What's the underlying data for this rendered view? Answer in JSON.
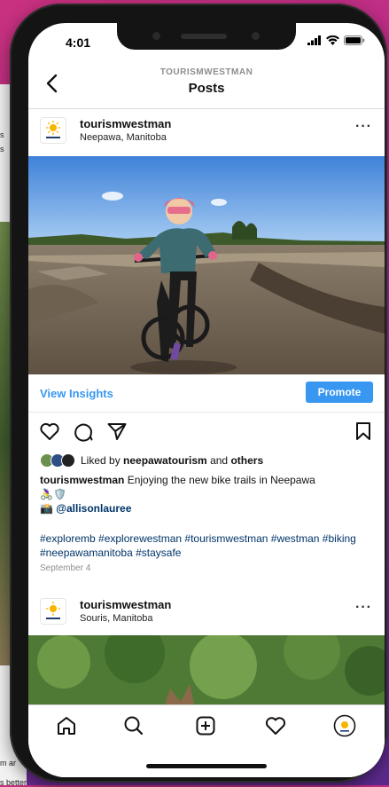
{
  "status": {
    "time": "4:01"
  },
  "header": {
    "account_label": "TOURISMWESTMAN",
    "title": "Posts"
  },
  "posts": [
    {
      "username": "tourismwestman",
      "location": "Neepawa, Manitoba",
      "insights_label": "View Insights",
      "promote_label": "Promote",
      "liked_by_prefix": "Liked by ",
      "liked_by_user": "neepawatourism",
      "liked_by_and": " and ",
      "liked_by_others": "others",
      "caption_user": "tourismwestman",
      "caption_text": " Enjoying the new bike trails in Neepawa",
      "caption_emoji": "🚴‍♀️🛡️",
      "mention_emoji": "📸",
      "mention": "@allisonlauree",
      "hashtags": "#exploremb #explorewestman #tourismwestman #westman #biking #neepawamanitoba #staysafe",
      "date": "September 4"
    },
    {
      "username": "tourismwestman",
      "location": "Souris, Manitoba"
    }
  ],
  "nav": [
    "home-icon",
    "search-icon",
    "add-post-icon",
    "activity-heart-icon",
    "profile-avatar"
  ],
  "colors": {
    "accent": "#3897f0",
    "hashtag": "#003569",
    "background_gradient": [
      "#c8317e",
      "#5a2a8c"
    ]
  },
  "background_page": {
    "text_lines": [
      "s",
      "s",
      "m ar",
      "s better"
    ]
  }
}
